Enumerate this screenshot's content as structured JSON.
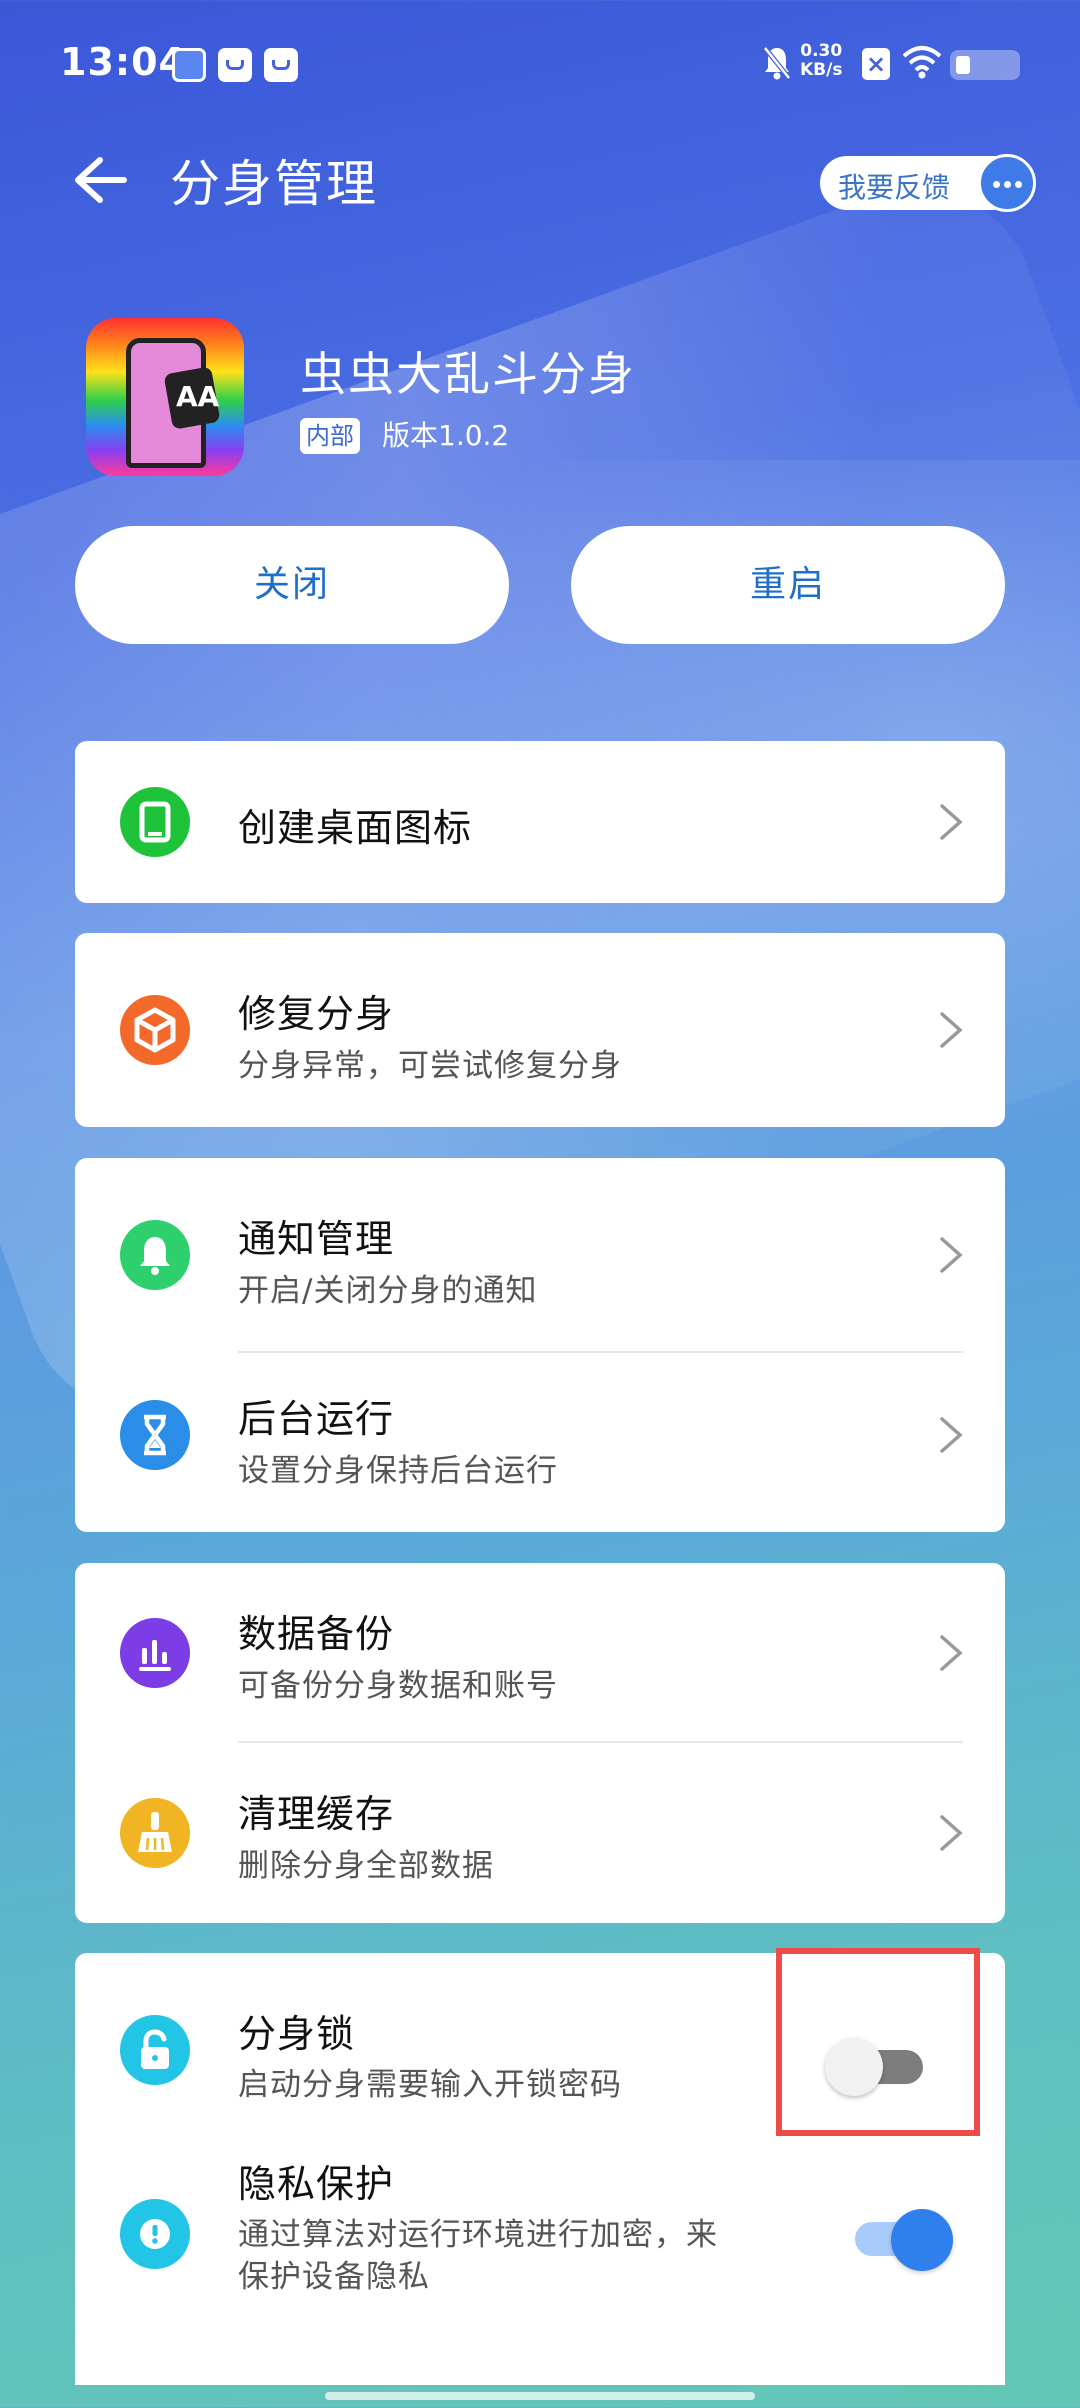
{
  "status_bar": {
    "time": "13:04",
    "net_speed": "0.30",
    "net_unit": "KB/s"
  },
  "header": {
    "title": "分身管理",
    "feedback_label": "我要反馈"
  },
  "app": {
    "name": "虫虫大乱斗分身",
    "tag": "内部",
    "version": "版本1.0.2"
  },
  "actions": {
    "close_label": "关闭",
    "restart_label": "重启"
  },
  "menu": {
    "shortcut": {
      "title": "创建桌面图标",
      "icon": "tablet-icon",
      "color": "#1ec339"
    },
    "repair": {
      "title": "修复分身",
      "subtitle": "分身异常，可尝试修复分身",
      "icon": "box-icon",
      "color": "#f2692a"
    },
    "notify": {
      "title": "通知管理",
      "subtitle": "开启/关闭分身的通知",
      "icon": "bell-icon",
      "color": "#2ed06e"
    },
    "background": {
      "title": "后台运行",
      "subtitle": "设置分身保持后台运行",
      "icon": "hourglass-icon",
      "color": "#2a8de8"
    },
    "backup": {
      "title": "数据备份",
      "subtitle": "可备份分身数据和账号",
      "icon": "bar-chart-icon",
      "color": "#7c3de6"
    },
    "clean": {
      "title": "清理缓存",
      "subtitle": "删除分身全部数据",
      "icon": "broom-icon",
      "color": "#f1b524"
    },
    "lock": {
      "title": "分身锁",
      "subtitle": "启动分身需要输入开锁密码",
      "icon": "lock-icon",
      "color": "#22c5e6",
      "enabled": false
    },
    "privacy": {
      "title": "隐私保护",
      "subtitle_line1": "通过算法对运行环境进行加密，来",
      "subtitle_line2": "保护设备隐私",
      "icon": "alert-icon",
      "color": "#22c5e6",
      "enabled": true
    }
  }
}
